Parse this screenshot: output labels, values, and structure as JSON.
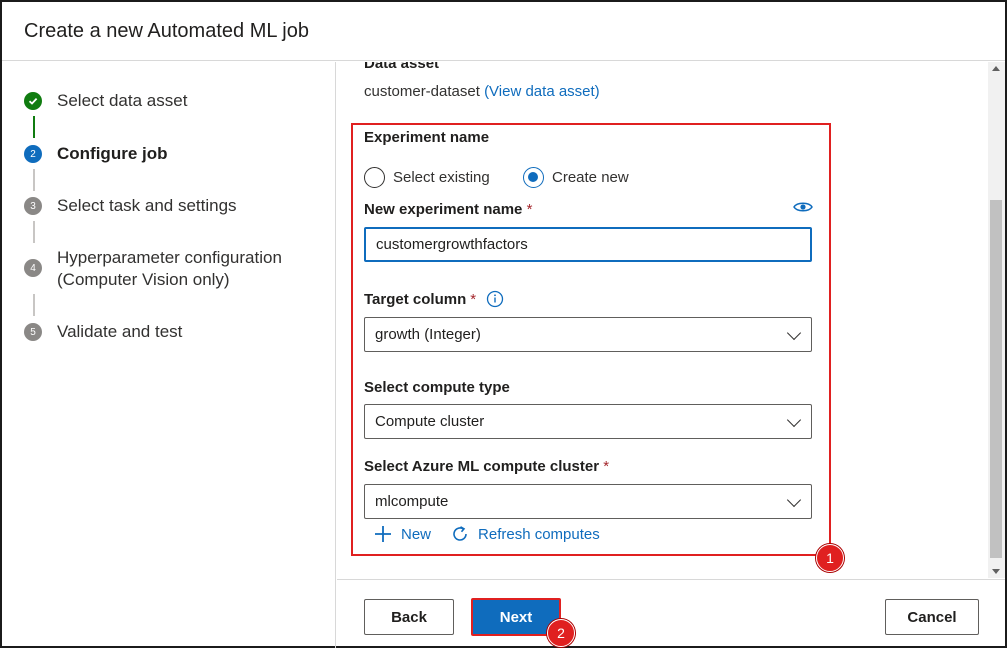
{
  "dialog": {
    "title": "Create a new Automated ML job"
  },
  "steps": [
    {
      "number": "1",
      "label": "Select data asset",
      "state": "done"
    },
    {
      "number": "2",
      "label": "Configure job",
      "state": "active"
    },
    {
      "number": "3",
      "label": "Select task and settings",
      "state": "pending"
    },
    {
      "number": "4",
      "label": "Hyperparameter configuration (Computer Vision only)",
      "state": "pending"
    },
    {
      "number": "5",
      "label": "Validate and test",
      "state": "pending"
    }
  ],
  "data_asset": {
    "label": "Data asset",
    "value": "customer-dataset",
    "link": "(View data asset)"
  },
  "experiment": {
    "label": "Experiment name",
    "options": [
      "Select existing",
      "Create new"
    ],
    "selected": "Create new",
    "new_name_label": "New experiment name",
    "new_name_value": "customergrowthfactors"
  },
  "target_column": {
    "label": "Target column",
    "value": "growth (Integer)"
  },
  "compute_type": {
    "label": "Select compute type",
    "value": "Compute cluster"
  },
  "compute_cluster": {
    "label": "Select Azure ML compute cluster",
    "value": "mlcompute",
    "new_label": "New",
    "refresh_label": "Refresh computes"
  },
  "required_mark": "*",
  "callouts": [
    "1",
    "2"
  ],
  "footer": {
    "back": "Back",
    "next": "Next",
    "cancel": "Cancel"
  },
  "colors": {
    "accent": "#0f6cbd",
    "success": "#107c10",
    "highlight": "#e02020"
  }
}
